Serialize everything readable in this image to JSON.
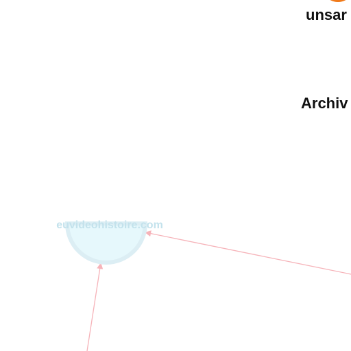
{
  "graph": {
    "nodes": [
      {
        "id": "unsar",
        "label": "unsar",
        "color": "#f07a1a",
        "label_color": "#111111"
      },
      {
        "id": "archiv",
        "label": "Archiv",
        "label_color": "#111111"
      },
      {
        "id": "euvideohistoire",
        "label": "euvideohistoire.com",
        "fill": "#e6f8fc",
        "stroke": "#d4ecf3",
        "label_color": "#c3e2ec"
      }
    ],
    "edges": [
      {
        "from": "offscreen-right",
        "to": "euvideohistoire",
        "color": "#f6b3b9"
      },
      {
        "from": "offscreen-bottom",
        "to": "euvideohistoire",
        "color": "#f6b3b9"
      }
    ]
  }
}
